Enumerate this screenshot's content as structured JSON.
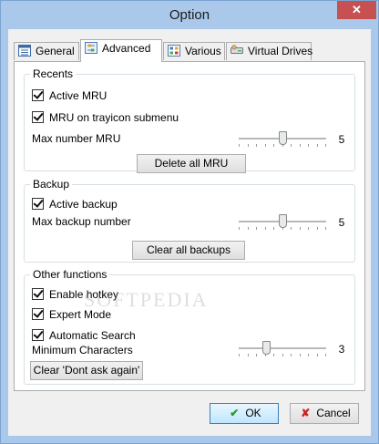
{
  "window": {
    "title": "Option",
    "close_glyph": "✕"
  },
  "tabs": [
    {
      "label": "General",
      "icon": "list-icon"
    },
    {
      "label": "Advanced",
      "icon": "options-icon",
      "active": true
    },
    {
      "label": "Various",
      "icon": "grid-icon"
    },
    {
      "label": "Virtual Drives",
      "icon": "drives-icon"
    }
  ],
  "recents": {
    "title": "Recents",
    "active_mru": {
      "label": "Active MRU",
      "checked": true
    },
    "mru_tray": {
      "label": "MRU on trayicon submenu",
      "checked": true
    },
    "max_label": "Max number MRU",
    "max_value": "5",
    "slider_fraction": 0.5,
    "delete_button": "Delete all MRU"
  },
  "backup": {
    "title": "Backup",
    "active_backup": {
      "label": "Active backup",
      "checked": true
    },
    "max_label": "Max backup number",
    "max_value": "5",
    "slider_fraction": 0.5,
    "clear_button": "Clear all backups"
  },
  "other": {
    "title": "Other functions",
    "enable_hotkey": {
      "label": "Enable hotkey",
      "checked": true
    },
    "expert_mode": {
      "label": "Expert Mode",
      "checked": true
    },
    "auto_search": {
      "label": "Automatic Search",
      "checked": true
    },
    "min_label": "Minimum Characters",
    "min_value": "3",
    "slider_fraction": 0.3,
    "clear_dont_ask_button": "Clear 'Dont ask again'"
  },
  "footer": {
    "ok": "OK",
    "cancel": "Cancel"
  },
  "colors": {
    "ok_check": "#2a9a2a",
    "cancel_x": "#cc2222",
    "close_button": "#c75050"
  },
  "watermark": "SOFTPEDIA"
}
